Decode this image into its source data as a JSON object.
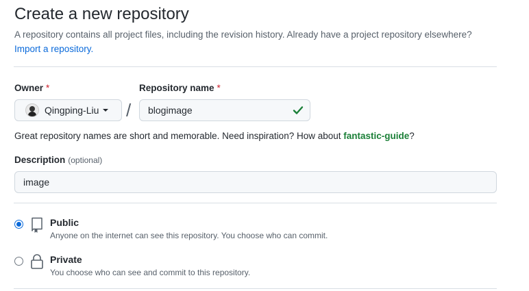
{
  "header": {
    "title": "Create a new repository",
    "subtitle": "A repository contains all project files, including the revision history. Already have a project repository elsewhere?",
    "import_link": "Import a repository."
  },
  "owner": {
    "label": "Owner",
    "required_mark": "*",
    "selected": "Qingping-Liu"
  },
  "separator": "/",
  "repo_name": {
    "label": "Repository name",
    "required_mark": "*",
    "value": "blogimage",
    "valid": true
  },
  "name_hint": {
    "text": "Great repository names are short and memorable. Need inspiration? How about ",
    "suggestion": "fantastic-guide",
    "suffix": "?"
  },
  "description": {
    "label": "Description",
    "optional": "(optional)",
    "value": "image"
  },
  "visibility": {
    "options": [
      {
        "title": "Public",
        "desc": "Anyone on the internet can see this repository. You choose who can commit.",
        "checked": true,
        "icon": "repo-icon"
      },
      {
        "title": "Private",
        "desc": "You choose who can see and commit to this repository.",
        "checked": false,
        "icon": "lock-icon"
      }
    ]
  },
  "colors": {
    "link": "#0969da",
    "success": "#1a7f37",
    "required": "#cf222e"
  }
}
